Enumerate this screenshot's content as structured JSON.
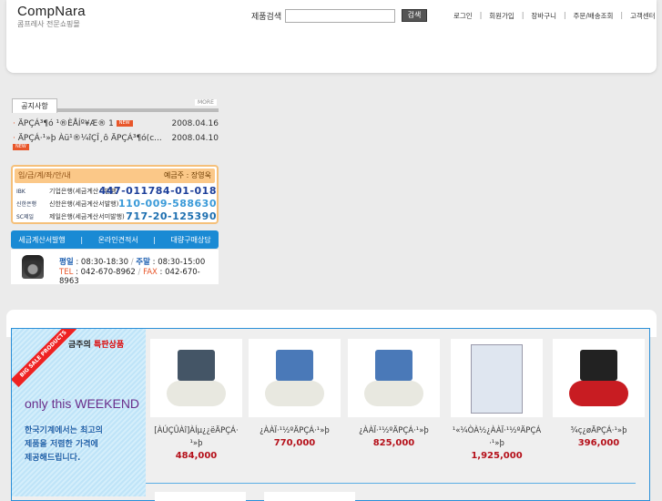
{
  "header": {
    "logo": "CompNara",
    "logo_sub": "콤프레사 전문쇼핑몰",
    "search_label": "제품검색",
    "search_value": "",
    "search_button": "검색",
    "nav": [
      "로그인",
      "회원가입",
      "장바구니",
      "주문/배송조회",
      "고객센터"
    ]
  },
  "notice": {
    "tab": "공지사항",
    "more": "MORE",
    "new_badge": "NEW",
    "items": [
      {
        "title": "ÄPÇÁ³¶ó ¹®ÈÅÍº¥Æ® 1",
        "date": "2008.04.16"
      },
      {
        "title": "ÄPÇÁ·¹»þ Àü¹®¼îÇÎ¸ô ÄPÇÁ³¶ó(c...",
        "date": "2008.04.10"
      }
    ]
  },
  "bank": {
    "title": "입/금/계/좌/안/내",
    "owner": "예금주 : 장영욱",
    "accounts": [
      {
        "logo": "IBK",
        "bank": "기업은행(세금계산서발행)",
        "number": "447-011784-01-018",
        "color": "#1d3f9a"
      },
      {
        "logo": "신한은행",
        "bank": "신한은행(세금계산서발행)",
        "number": "110-009-588630",
        "color": "#3a9ad8"
      },
      {
        "logo": "SC제일",
        "bank": "제일은행(세금계산서미발행)",
        "number": "717-20-125390",
        "color": "#1d6fb0"
      }
    ]
  },
  "links": [
    "세금계산서발행",
    "온라인견적서",
    "대량구매상담"
  ],
  "contact": {
    "weekday_label": "평일",
    "weekday": "08:30-18:30",
    "weekend_label": "주말",
    "weekend": "08:30-15:00",
    "tel_label": "TEL",
    "tel": "042-670-8962",
    "fax_label": "FAX",
    "fax": "042-670-8963"
  },
  "promo": {
    "ribbon": "BIG SALE PRODUCTS",
    "title_a": "금주의 ",
    "title_b": "특판상품",
    "weekend": "only this WEEKEND",
    "lines": [
      "한국기계에서는 최고의",
      "제품을 저렴한 가격에",
      "제공해드립니다."
    ]
  },
  "products": [
    {
      "name": "[ÀÚÇÛÀî]ÀÍµ¿¿ëÄPÇÁ·¹»þ",
      "price": "484,000"
    },
    {
      "name": "¿ÀÀÏ·¹½ºÄPÇÁ·¹»þ",
      "price": "770,000"
    },
    {
      "name": "¿ÀÀÏ·¹½ºÄPÇÁ·¹»þ",
      "price": "825,000"
    },
    {
      "name": "¹«¼ÒÀ½¿ÀÀÏ·¹½ºÄPÇÁ·¹»þ",
      "price": "1,925,000"
    },
    {
      "name": "¾ç¿øÄPÇÁ·¹»þ",
      "price": "396,000"
    }
  ]
}
